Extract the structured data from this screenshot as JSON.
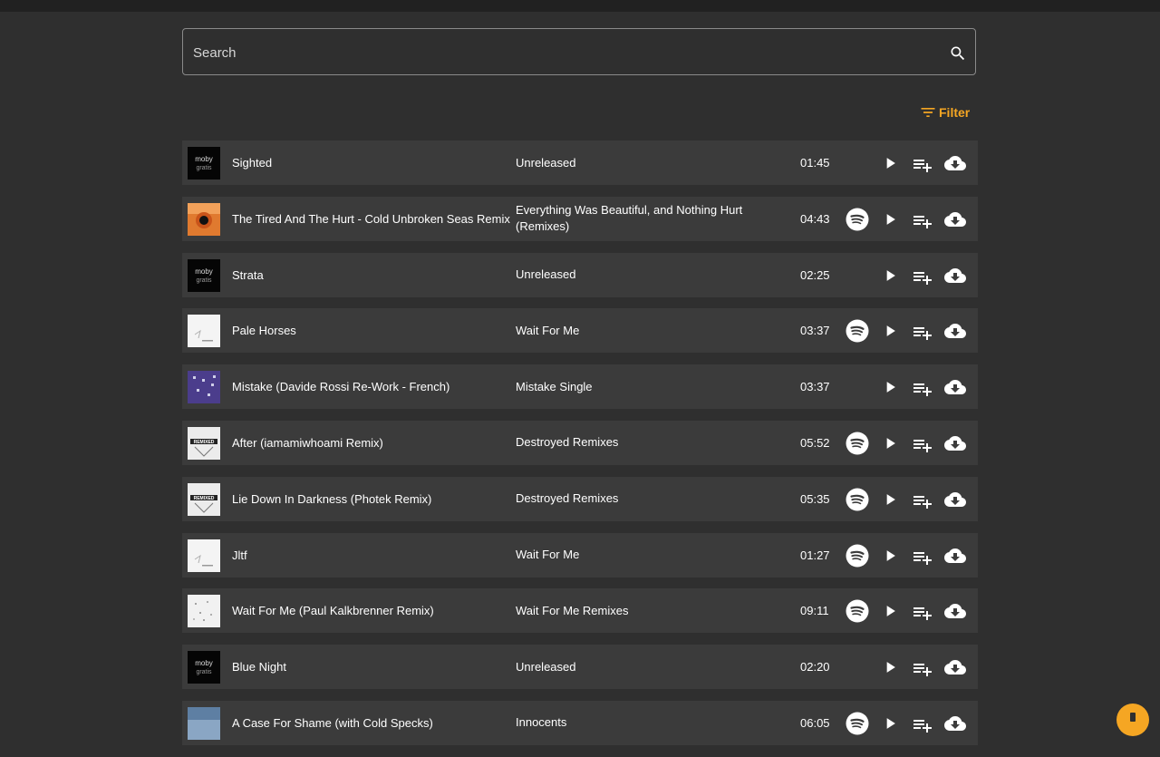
{
  "search": {
    "placeholder": "Search",
    "value": ""
  },
  "filter": {
    "label": "Filter"
  },
  "accent_color": "#f5a623",
  "tracks": [
    {
      "title": "Sighted",
      "album": "Unreleased",
      "duration": "01:45",
      "spotify": false,
      "art": "moby-gratis"
    },
    {
      "title": "The Tired And The Hurt - Cold Unbroken Seas Remix",
      "album": "Everything Was Beautiful, and Nothing Hurt (Remixes)",
      "duration": "04:43",
      "spotify": true,
      "art": "orange"
    },
    {
      "title": "Strata",
      "album": "Unreleased",
      "duration": "02:25",
      "spotify": false,
      "art": "moby-gratis"
    },
    {
      "title": "Pale Horses",
      "album": "Wait For Me",
      "duration": "03:37",
      "spotify": true,
      "art": "white"
    },
    {
      "title": "Mistake (Davide Rossi Re-Work - French)",
      "album": "Mistake Single",
      "duration": "03:37",
      "spotify": false,
      "art": "purple"
    },
    {
      "title": "After (iamamiwhoami Remix)",
      "album": "Destroyed Remixes",
      "duration": "05:52",
      "spotify": true,
      "art": "remixed"
    },
    {
      "title": "Lie Down In Darkness (Photek Remix)",
      "album": "Destroyed Remixes",
      "duration": "05:35",
      "spotify": true,
      "art": "remixed"
    },
    {
      "title": "Jltf",
      "album": "Wait For Me",
      "duration": "01:27",
      "spotify": true,
      "art": "white"
    },
    {
      "title": "Wait For Me (Paul Kalkbrenner Remix)",
      "album": "Wait For Me Remixes",
      "duration": "09:11",
      "spotify": true,
      "art": "white-scatter"
    },
    {
      "title": "Blue Night",
      "album": "Unreleased",
      "duration": "02:20",
      "spotify": false,
      "art": "moby-gratis"
    },
    {
      "title": "A Case For Shame (with Cold Specks)",
      "album": "Innocents",
      "duration": "06:05",
      "spotify": true,
      "art": "blue"
    }
  ],
  "art_text": {
    "moby": "moby",
    "gratis": "gratis",
    "remixed": "REMIXED"
  }
}
